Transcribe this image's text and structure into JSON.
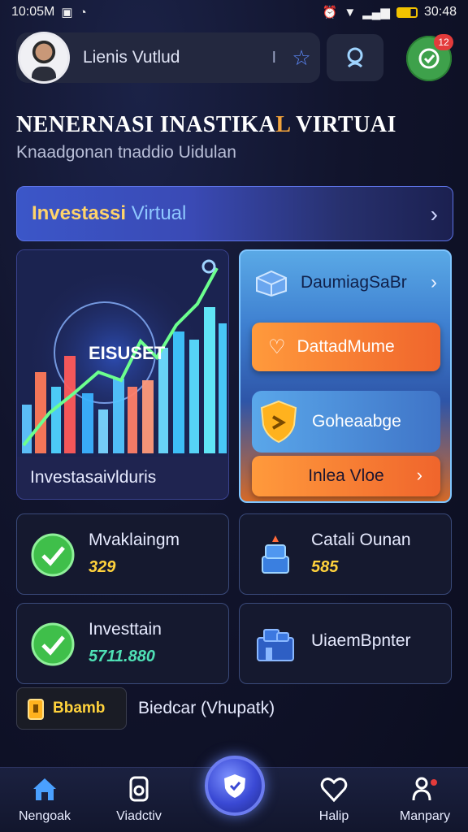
{
  "status_bar": {
    "time_left": "10:05M",
    "time_right": "30:48"
  },
  "header": {
    "user_name": "Lienis Vutlud",
    "cursor": "I"
  },
  "notifications": {
    "badge": "12"
  },
  "page": {
    "title_main": "NENERNASI INASTIKA",
    "title_accent": "L",
    "title_tail": " VIRTUAI",
    "subtitle": "Knaadgonan tnaddio Uidulan"
  },
  "banner": {
    "text_main": "Investassi ",
    "text_accent": "Virtual"
  },
  "feature_card": {
    "art_label": "EISUSET",
    "label": "Investasaivlduris"
  },
  "side_panel": {
    "row1_label": "DaumiagSaBr",
    "button1_label": "DattadMume",
    "mid_label": "Goheaabge",
    "button2_label": "Inlea Vloe"
  },
  "stats": [
    {
      "title": "Mvaklaingm",
      "value": "329",
      "value_color": "#ffd23c"
    },
    {
      "title": "Catali Ounan",
      "value": "585",
      "value_color": "#ffd23c"
    },
    {
      "title": "Investtain",
      "value": "5711.880",
      "value_color": "#4fe0b5"
    },
    {
      "title": "UiaemBpnter",
      "value": "",
      "value_color": "#4fe0b5"
    }
  ],
  "bottom": {
    "chip_label": "Bbamb",
    "link_label": "Biedcar (Vhupatk)"
  },
  "nav": [
    {
      "label": "Nengoak",
      "icon": "home-icon",
      "color": "#4aa0ff"
    },
    {
      "label": "Viadctiv",
      "icon": "device-icon",
      "color": "#ffffff"
    },
    {
      "label": "Halip",
      "icon": "heart-icon",
      "color": "#ffffff"
    },
    {
      "label": "Manpary",
      "icon": "people-icon",
      "color": "#ffffff"
    }
  ]
}
